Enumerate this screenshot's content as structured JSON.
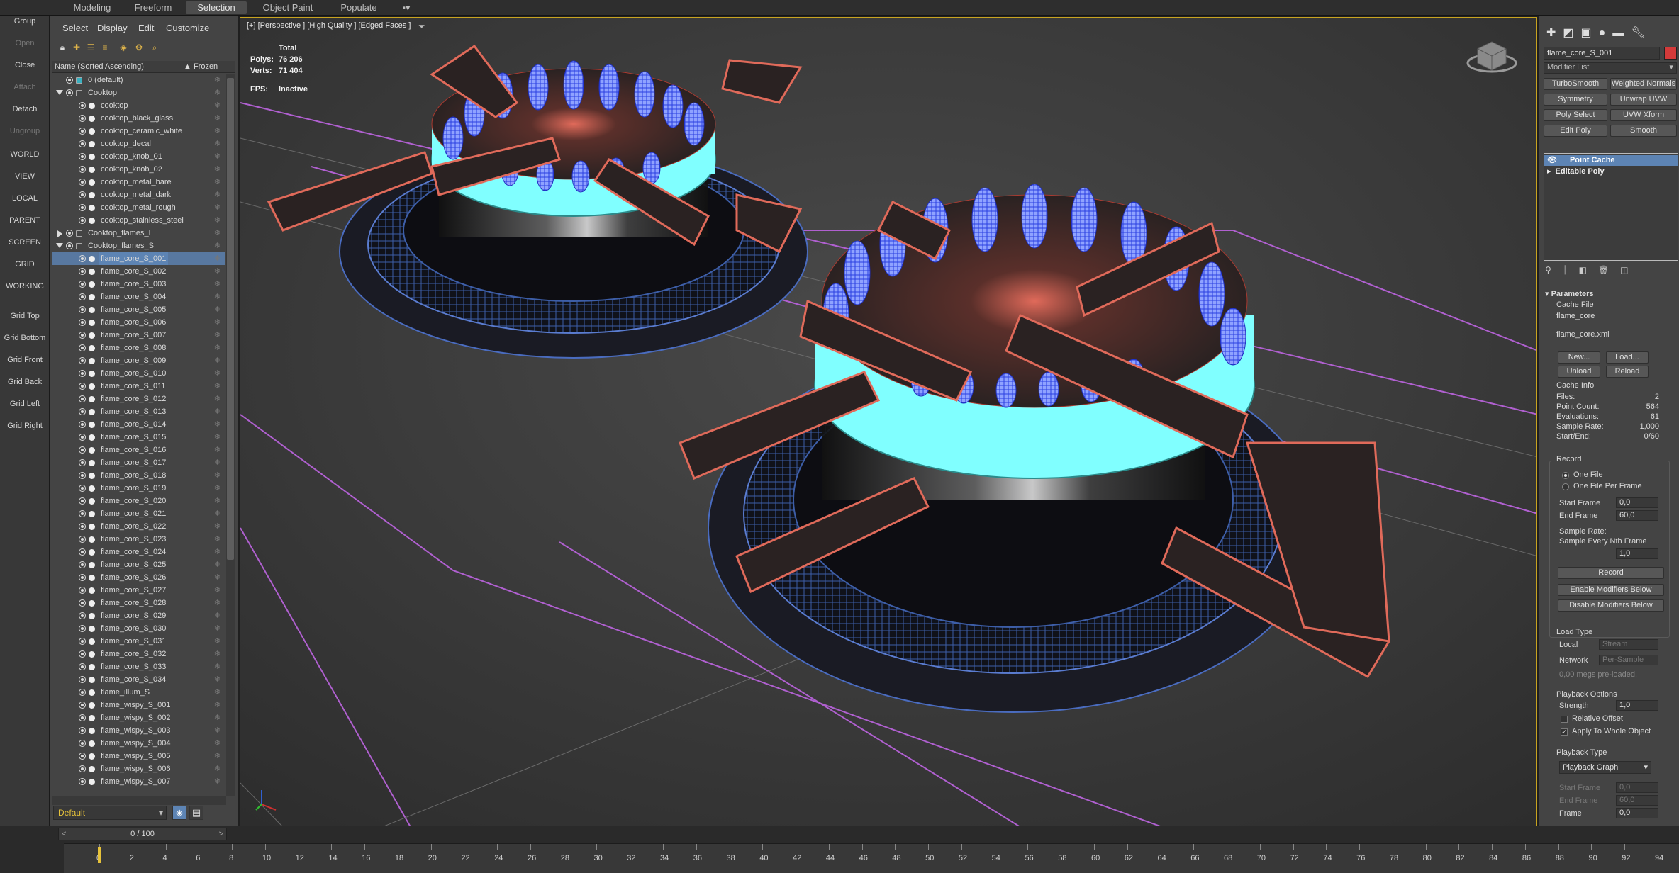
{
  "ribbon": {
    "tabs": [
      "Modeling",
      "Freeform",
      "Selection",
      "Object Paint",
      "Populate"
    ],
    "active": "Selection"
  },
  "left_strip": {
    "buttons": [
      "Group",
      "Open",
      "Close",
      "Attach",
      "Detach",
      "Ungroup",
      "WORLD",
      "VIEW",
      "LOCAL",
      "PARENT",
      "SCREEN",
      "GRID",
      "WORKING",
      "Grid Top",
      "Grid Bottom",
      "Grid Front",
      "Grid Back",
      "Grid Left",
      "Grid Right"
    ],
    "disabled": [
      "Open",
      "Attach",
      "Ungroup"
    ]
  },
  "explorer": {
    "menu": [
      "Select",
      "Display",
      "Edit",
      "Customize"
    ],
    "column_name": "Name (Sorted Ascending)",
    "column_frozen": "▲ Frozen",
    "rows": [
      {
        "name": "0 (default)",
        "level": 0,
        "kind": "layer"
      },
      {
        "name": "Cooktop",
        "level": 0,
        "kind": "layer",
        "expanded": true
      },
      {
        "name": "cooktop",
        "level": 1,
        "kind": "object"
      },
      {
        "name": "cooktop_black_glass",
        "level": 1,
        "kind": "object"
      },
      {
        "name": "cooktop_ceramic_white",
        "level": 1,
        "kind": "object"
      },
      {
        "name": "cooktop_decal",
        "level": 1,
        "kind": "object"
      },
      {
        "name": "cooktop_knob_01",
        "level": 1,
        "kind": "object"
      },
      {
        "name": "cooktop_knob_02",
        "level": 1,
        "kind": "object"
      },
      {
        "name": "cooktop_metal_bare",
        "level": 1,
        "kind": "object"
      },
      {
        "name": "cooktop_metal_dark",
        "level": 1,
        "kind": "object"
      },
      {
        "name": "cooktop_metal_rough",
        "level": 1,
        "kind": "object"
      },
      {
        "name": "cooktop_stainless_steel",
        "level": 1,
        "kind": "object"
      },
      {
        "name": "Cooktop_flames_L",
        "level": 0,
        "kind": "layer",
        "expanded": false
      },
      {
        "name": "Cooktop_flames_S",
        "level": 0,
        "kind": "layer",
        "expanded": true
      },
      {
        "name": "flame_core_S_001",
        "level": 1,
        "kind": "object",
        "selected": true
      },
      {
        "name": "flame_core_S_002",
        "level": 1,
        "kind": "object"
      },
      {
        "name": "flame_core_S_003",
        "level": 1,
        "kind": "object"
      },
      {
        "name": "flame_core_S_004",
        "level": 1,
        "kind": "object"
      },
      {
        "name": "flame_core_S_005",
        "level": 1,
        "kind": "object"
      },
      {
        "name": "flame_core_S_006",
        "level": 1,
        "kind": "object"
      },
      {
        "name": "flame_core_S_007",
        "level": 1,
        "kind": "object"
      },
      {
        "name": "flame_core_S_008",
        "level": 1,
        "kind": "object"
      },
      {
        "name": "flame_core_S_009",
        "level": 1,
        "kind": "object"
      },
      {
        "name": "flame_core_S_010",
        "level": 1,
        "kind": "object"
      },
      {
        "name": "flame_core_S_011",
        "level": 1,
        "kind": "object"
      },
      {
        "name": "flame_core_S_012",
        "level": 1,
        "kind": "object"
      },
      {
        "name": "flame_core_S_013",
        "level": 1,
        "kind": "object"
      },
      {
        "name": "flame_core_S_014",
        "level": 1,
        "kind": "object"
      },
      {
        "name": "flame_core_S_015",
        "level": 1,
        "kind": "object"
      },
      {
        "name": "flame_core_S_016",
        "level": 1,
        "kind": "object"
      },
      {
        "name": "flame_core_S_017",
        "level": 1,
        "kind": "object"
      },
      {
        "name": "flame_core_S_018",
        "level": 1,
        "kind": "object"
      },
      {
        "name": "flame_core_S_019",
        "level": 1,
        "kind": "object"
      },
      {
        "name": "flame_core_S_020",
        "level": 1,
        "kind": "object"
      },
      {
        "name": "flame_core_S_021",
        "level": 1,
        "kind": "object"
      },
      {
        "name": "flame_core_S_022",
        "level": 1,
        "kind": "object"
      },
      {
        "name": "flame_core_S_023",
        "level": 1,
        "kind": "object"
      },
      {
        "name": "flame_core_S_024",
        "level": 1,
        "kind": "object"
      },
      {
        "name": "flame_core_S_025",
        "level": 1,
        "kind": "object"
      },
      {
        "name": "flame_core_S_026",
        "level": 1,
        "kind": "object"
      },
      {
        "name": "flame_core_S_027",
        "level": 1,
        "kind": "object"
      },
      {
        "name": "flame_core_S_028",
        "level": 1,
        "kind": "object"
      },
      {
        "name": "flame_core_S_029",
        "level": 1,
        "kind": "object"
      },
      {
        "name": "flame_core_S_030",
        "level": 1,
        "kind": "object"
      },
      {
        "name": "flame_core_S_031",
        "level": 1,
        "kind": "object"
      },
      {
        "name": "flame_core_S_032",
        "level": 1,
        "kind": "object"
      },
      {
        "name": "flame_core_S_033",
        "level": 1,
        "kind": "object"
      },
      {
        "name": "flame_core_S_034",
        "level": 1,
        "kind": "object"
      },
      {
        "name": "flame_illum_S",
        "level": 1,
        "kind": "object"
      },
      {
        "name": "flame_wispy_S_001",
        "level": 1,
        "kind": "object"
      },
      {
        "name": "flame_wispy_S_002",
        "level": 1,
        "kind": "object"
      },
      {
        "name": "flame_wispy_S_003",
        "level": 1,
        "kind": "object"
      },
      {
        "name": "flame_wispy_S_004",
        "level": 1,
        "kind": "object"
      },
      {
        "name": "flame_wispy_S_005",
        "level": 1,
        "kind": "object"
      },
      {
        "name": "flame_wispy_S_006",
        "level": 1,
        "kind": "object"
      },
      {
        "name": "flame_wispy_S_007",
        "level": 1,
        "kind": "object"
      }
    ],
    "layer_dropdown": "Default"
  },
  "viewport": {
    "label": "[+] [Perspective ] [High Quality ] [Edged Faces ]",
    "stats_total": "Total",
    "polys_label": "Polys:",
    "polys_value": "76 206",
    "verts_label": "Verts:",
    "verts_value": "71 404",
    "fps_label": "FPS:",
    "fps_value": "Inactive"
  },
  "command_panel": {
    "object_name": "flame_core_S_001",
    "object_color": "#d43a3a",
    "modifier_list": "Modifier List",
    "mod_buttons": [
      "TurboSmooth",
      "Weighted Normals",
      "Symmetry",
      "Unwrap UVW",
      "Poly Select",
      "UVW Xform",
      "Edit Poly",
      "Smooth"
    ],
    "stack": [
      "Point Cache",
      "Editable Poly"
    ],
    "params": {
      "rollout": "Parameters",
      "cache_file": "Cache File",
      "file_name": "flame_core",
      "file_path": "flame_core.xml",
      "new": "New...",
      "load": "Load...",
      "unload": "Unload",
      "reload": "Reload",
      "cache_info": "Cache Info",
      "files_label": "Files:",
      "files": "2",
      "point_count_label": "Point Count:",
      "point_count": "564",
      "evaluations_label": "Evaluations:",
      "evaluations": "61",
      "sample_rate_label": "Sample Rate:",
      "sample_rate": "1,000",
      "start_end_label": "Start/End:",
      "start_end": "0/60",
      "record_group": "Record",
      "one_file": "One File",
      "one_file_per_frame": "One File Per Frame",
      "start_frame_label": "Start Frame",
      "start_frame": "0,0",
      "end_frame_label": "End Frame",
      "end_frame": "60,0",
      "sample_rate2": "Sample Rate:",
      "sample_nth": "Sample Every Nth Frame",
      "nth": "1,0",
      "record_btn": "Record",
      "enable_mods": "Enable Modifiers Below",
      "disable_mods": "Disable Modifiers Below",
      "load_type": "Load Type",
      "local_label": "Local",
      "local_val": "Stream",
      "network_label": "Network",
      "network_val": "Per-Sample",
      "preloaded": "0,00 megs pre-loaded.",
      "playback_options": "Playback Options",
      "strength_label": "Strength",
      "strength": "1,0",
      "relative_offset": "Relative Offset",
      "apply_whole": "Apply To Whole Object",
      "playback_type": "Playback Type",
      "playback_graph": "Playback Graph",
      "pb_start_label": "Start Frame",
      "pb_start": "0,0",
      "pb_end_label": "End Frame",
      "pb_end": "60,0",
      "frame_label": "Frame",
      "frame": "0,0"
    }
  },
  "timeline": {
    "slider": "0 / 100",
    "ticks": [
      "0",
      "2",
      "4",
      "6",
      "8",
      "10",
      "12",
      "14",
      "16",
      "18",
      "20",
      "22",
      "24",
      "26",
      "28",
      "30",
      "32",
      "34",
      "36",
      "38",
      "40",
      "42",
      "44",
      "46",
      "48",
      "50",
      "52",
      "54",
      "56",
      "58",
      "60",
      "62",
      "64",
      "66",
      "68",
      "70",
      "72",
      "74",
      "76",
      "78",
      "80",
      "82",
      "84",
      "86",
      "88",
      "90",
      "92",
      "94"
    ]
  },
  "colors": {
    "accent": "#5d84b4",
    "frame": "#c8a420",
    "wire_red": "#e06a5a",
    "flame_cyan": "#80ffff",
    "flame_blue": "#3a5aff",
    "purple": "#b060d0"
  }
}
